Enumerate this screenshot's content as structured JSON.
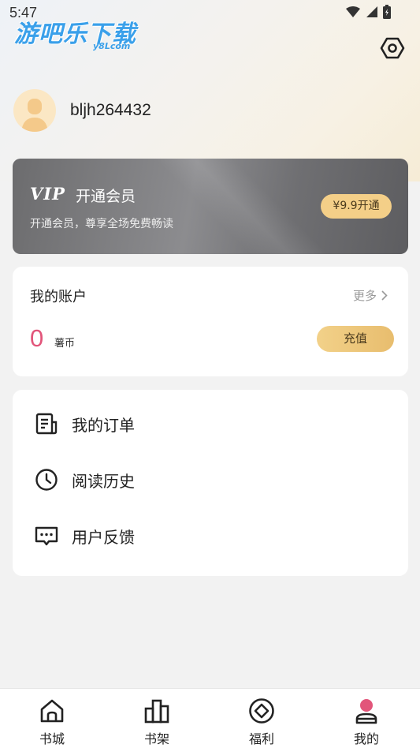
{
  "status_bar": {
    "time": "5:47"
  },
  "watermark": {
    "text": "游吧乐下载",
    "sub": "y8Lcom"
  },
  "profile": {
    "username": "bljh264432"
  },
  "vip": {
    "badge": "VIP",
    "title": "开通会员",
    "description": "开通会员，尊享全场免费畅读",
    "button_label": "¥9.9开通"
  },
  "account": {
    "title": "我的账户",
    "more_label": "更多",
    "coin_amount": "0",
    "coin_unit": "薯币",
    "recharge_label": "充值"
  },
  "menu": {
    "items": [
      {
        "label": "我的订单",
        "icon": "order-list-icon"
      },
      {
        "label": "阅读历史",
        "icon": "clock-icon"
      },
      {
        "label": "用户反馈",
        "icon": "feedback-chat-icon"
      }
    ]
  },
  "bottom_nav": {
    "items": [
      {
        "label": "书城",
        "icon": "home-icon"
      },
      {
        "label": "书架",
        "icon": "bookshelf-icon"
      },
      {
        "label": "福利",
        "icon": "diamond-icon"
      },
      {
        "label": "我的",
        "icon": "profile-icon"
      }
    ],
    "active_index": 3
  },
  "colors": {
    "accent_pink": "#e2557a",
    "gold_button": "#f4cf88",
    "vip_card": "#7b7b7e"
  }
}
